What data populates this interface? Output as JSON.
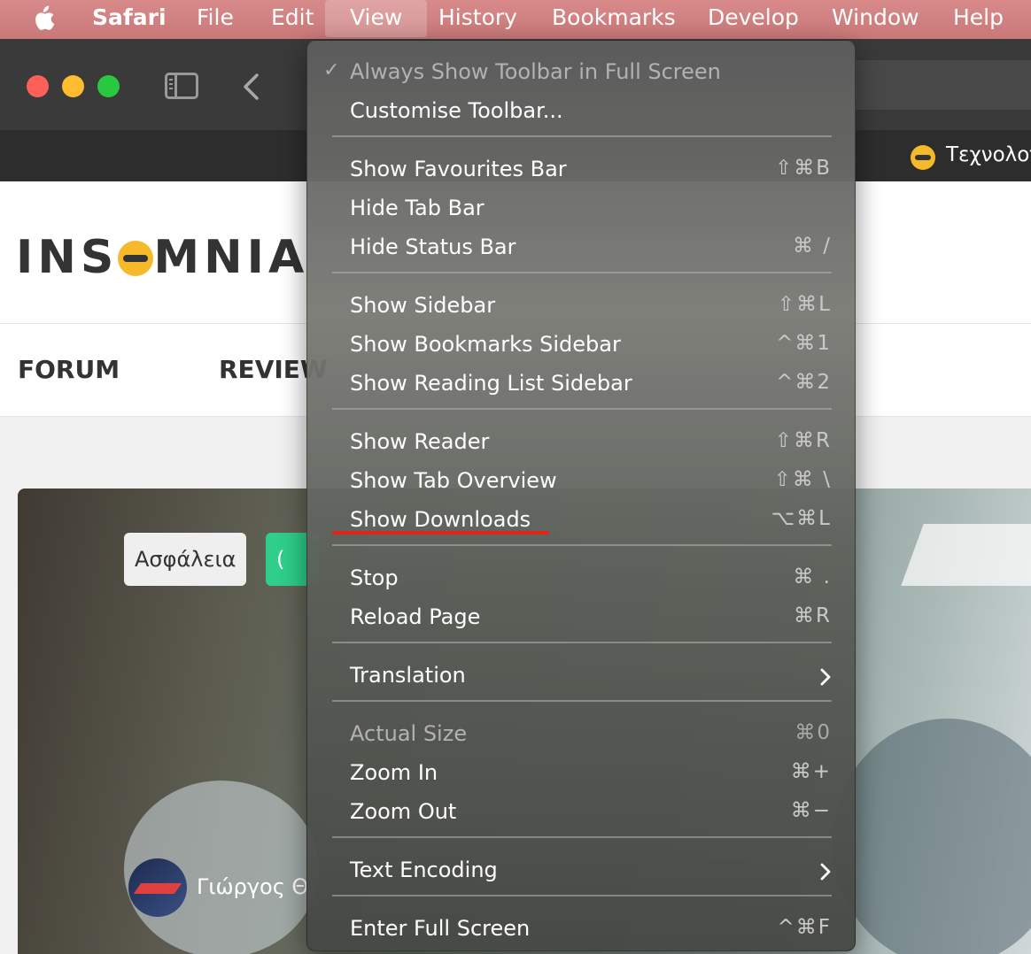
{
  "menubar": {
    "app": "Safari",
    "items": [
      "File",
      "Edit",
      "View",
      "History",
      "Bookmarks",
      "Develop",
      "Window",
      "Help"
    ],
    "active": "View"
  },
  "browser": {
    "tab_title": "Τεχνολογ"
  },
  "site": {
    "logo": "INSOMNIA",
    "nav": [
      "FORUM",
      "REVIEW"
    ],
    "hero": {
      "tags": [
        "Ασφάλεια",
        "("
      ],
      "author": "Γιώργος Θ"
    }
  },
  "view_menu": {
    "always_show_toolbar": {
      "label": "Always Show Toolbar in Full Screen",
      "checked": true,
      "enabled": false
    },
    "customise_toolbar": "Customise Toolbar...",
    "show_favourites_bar": {
      "label": "Show Favourites Bar",
      "shortcut": "⇧⌘B"
    },
    "hide_tab_bar": {
      "label": "Hide Tab Bar",
      "shortcut": ""
    },
    "hide_status_bar": {
      "label": "Hide Status Bar",
      "shortcut": "⌘ /"
    },
    "show_sidebar": {
      "label": "Show Sidebar",
      "shortcut": "⇧⌘L"
    },
    "show_bookmarks_sidebar": {
      "label": "Show Bookmarks Sidebar",
      "shortcut": "^⌘1"
    },
    "show_reading_list_sidebar": {
      "label": "Show Reading List Sidebar",
      "shortcut": "^⌘2"
    },
    "show_reader": {
      "label": "Show Reader",
      "shortcut": "⇧⌘R"
    },
    "show_tab_overview": {
      "label": "Show Tab Overview",
      "shortcut": "⇧⌘ \\"
    },
    "show_downloads": {
      "label": "Show Downloads",
      "shortcut": "⌥⌘L",
      "highlighted": true
    },
    "stop": {
      "label": "Stop",
      "shortcut": "⌘ ."
    },
    "reload_page": {
      "label": "Reload Page",
      "shortcut": "⌘R"
    },
    "translation": {
      "label": "Translation"
    },
    "actual_size": {
      "label": "Actual Size",
      "shortcut": "⌘0",
      "enabled": false
    },
    "zoom_in": {
      "label": "Zoom In",
      "shortcut": "⌘+"
    },
    "zoom_out": {
      "label": "Zoom Out",
      "shortcut": "⌘−"
    },
    "text_encoding": {
      "label": "Text Encoding"
    },
    "enter_full_screen": {
      "label": "Enter Full Screen",
      "shortcut": "^⌘F"
    }
  },
  "colors": {
    "menubar": "#c97878",
    "highlight_underline": "#e2231a",
    "brand_yellow": "#f5b92a",
    "tag_green": "#2fce8a"
  }
}
